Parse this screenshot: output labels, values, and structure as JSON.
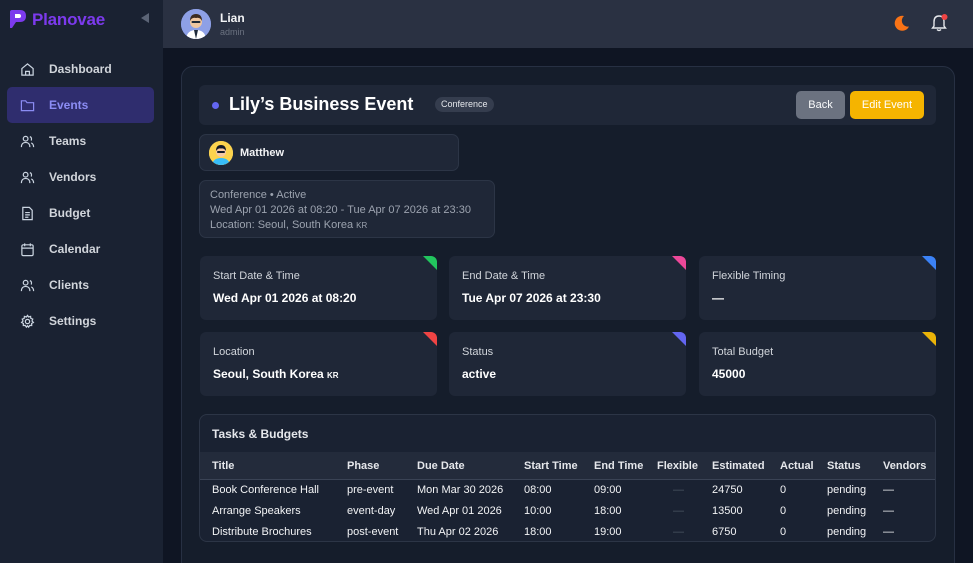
{
  "brand": {
    "name": "Planovae"
  },
  "nav": [
    {
      "label": "Dashboard",
      "icon": "home-icon"
    },
    {
      "label": "Events",
      "icon": "folder-icon",
      "active": true
    },
    {
      "label": "Teams",
      "icon": "users-icon"
    },
    {
      "label": "Vendors",
      "icon": "users-icon"
    },
    {
      "label": "Budget",
      "icon": "document-icon"
    },
    {
      "label": "Calendar",
      "icon": "calendar-icon"
    },
    {
      "label": "Clients",
      "icon": "users-icon"
    },
    {
      "label": "Settings",
      "icon": "gear-icon"
    }
  ],
  "user": {
    "name": "Lian",
    "role": "admin"
  },
  "event": {
    "title": "Lily’s Business Event",
    "type": "Conference",
    "back_label": "Back",
    "edit_label": "Edit Event",
    "client_name": "Matthew",
    "summary_line1": "Conference • Active",
    "summary_line2": "Wed Apr 01 2026 at 08:20 - Tue Apr 07 2026 at 23:30",
    "summary_line3": "Location: Seoul, South Korea",
    "summary_flag": "KR"
  },
  "stats": [
    {
      "label": "Start Date & Time",
      "value": "Wed Apr 01 2026 at 08:20",
      "color": "#22c55e"
    },
    {
      "label": "End Date & Time",
      "value": "Tue Apr 07 2026 at 23:30",
      "color": "#ec4899"
    },
    {
      "label": "Flexible Timing",
      "value": "—",
      "color": "#3b82f6"
    },
    {
      "label": "Location",
      "value": "Seoul, South Korea",
      "flag": "KR",
      "color": "#ef4444"
    },
    {
      "label": "Status",
      "value": "active",
      "color": "#6366f1"
    },
    {
      "label": "Total Budget",
      "value": "45000",
      "color": "#eab308"
    }
  ],
  "tasks": {
    "title": "Tasks & Budgets",
    "columns": [
      "Title",
      "Phase",
      "Due Date",
      "Start Time",
      "End Time",
      "Flexible",
      "Estimated",
      "Actual",
      "Status",
      "Vendors"
    ],
    "rows": [
      [
        "Book Conference Hall",
        "pre-event",
        "Mon Mar 30 2026",
        "08:00",
        "09:00",
        "—",
        "24750",
        "0",
        "pending",
        "—"
      ],
      [
        "Arrange Speakers",
        "event-day",
        "Wed Apr 01 2026",
        "10:00",
        "18:00",
        "—",
        "13500",
        "0",
        "pending",
        "—"
      ],
      [
        "Distribute Brochures",
        "post-event",
        "Thu Apr 02 2026",
        "18:00",
        "19:00",
        "—",
        "6750",
        "0",
        "pending",
        "—"
      ]
    ]
  }
}
